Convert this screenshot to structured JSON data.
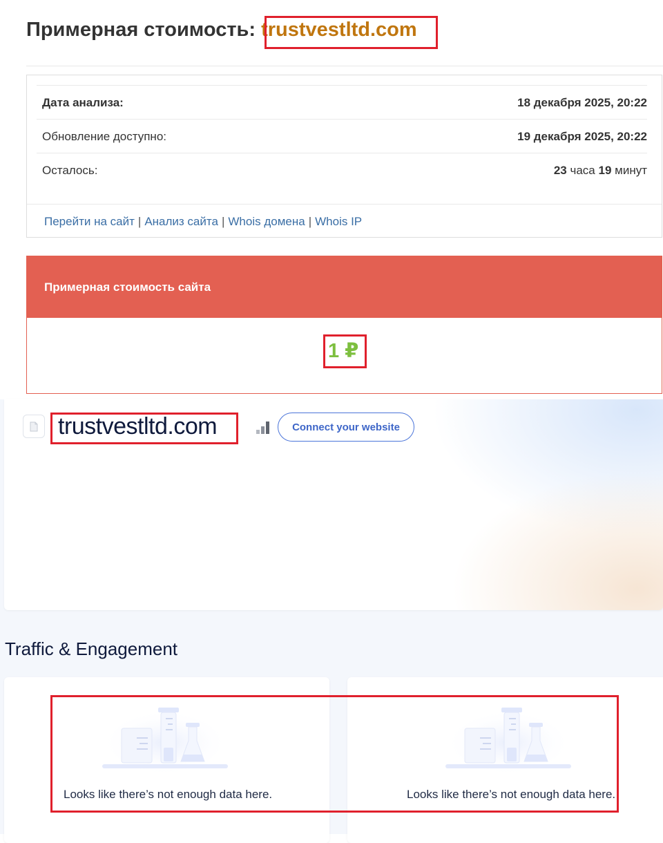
{
  "header": {
    "title_prefix": "Примерная стоимость:",
    "domain": "trustvestltd.com"
  },
  "info": {
    "rows": [
      {
        "label": "Дата анализа:",
        "value": "18 декабря 2025, 20:22"
      },
      {
        "label": "Обновление доступно:",
        "value": "19 декабря 2025, 20:22"
      }
    ],
    "remaining": {
      "label": "Осталось:",
      "hours": "23",
      "hours_unit": "часа",
      "minutes": "19",
      "minutes_unit": "минут"
    },
    "links": [
      "Перейти на сайт",
      "Анализ сайта",
      "Whois домена",
      "Whois IP"
    ],
    "separator": "|"
  },
  "valuation": {
    "heading": "Примерная стоимость сайта",
    "amount": "1 ₽"
  },
  "similarweb": {
    "domain": "trustvestltd.com",
    "connect_label": "Connect your website",
    "section_title": "Traffic & Engagement",
    "cards": [
      {
        "message": "Looks like there’s not enough data here."
      },
      {
        "message": "Looks like there’s not enough data here."
      }
    ]
  },
  "colors": {
    "accent_red": "#e36052",
    "domain_orange": "#c0760f",
    "value_green": "#7dbf3f",
    "link_blue": "#3a6ea5",
    "highlight_red": "#e0202c"
  }
}
